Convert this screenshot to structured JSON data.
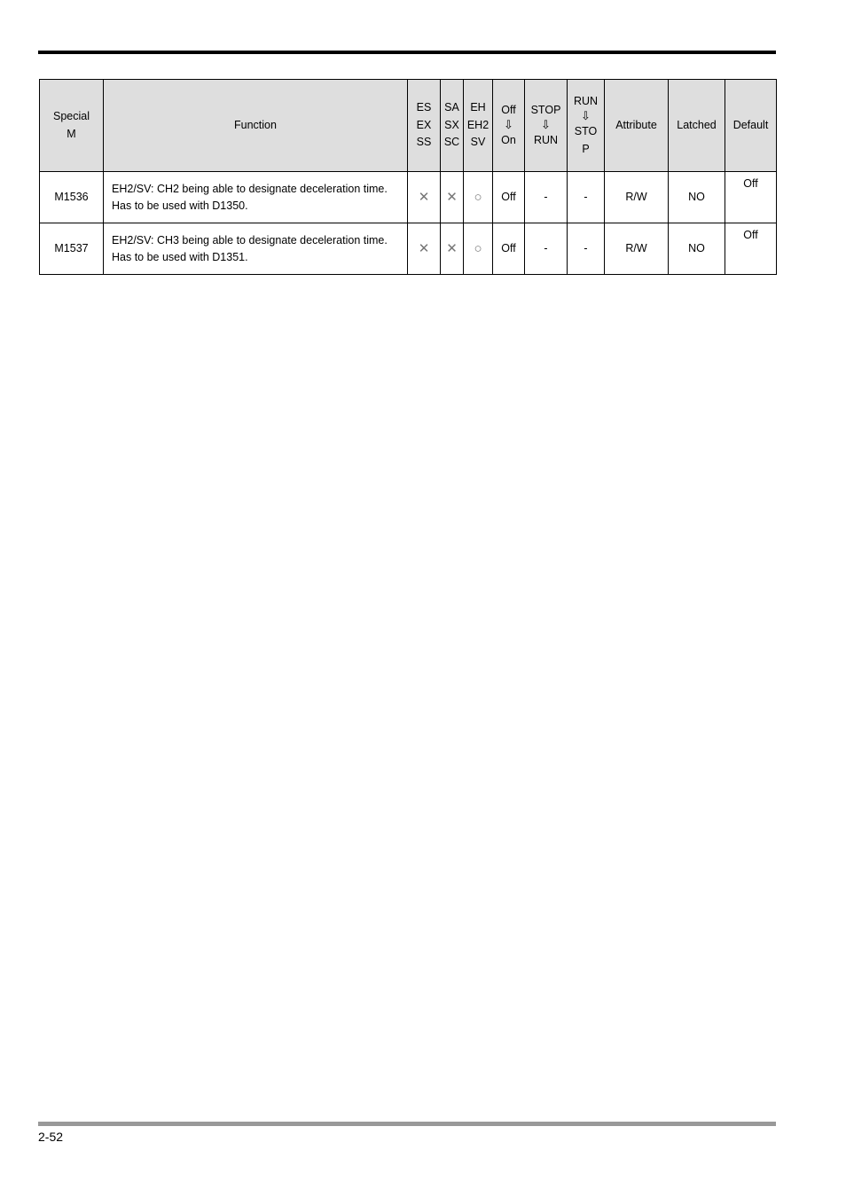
{
  "page": {
    "page_number": "2-52"
  },
  "table": {
    "headers": {
      "special_m": "Special\nM",
      "special_m_line1": "Special",
      "special_m_line2": "M",
      "function": "Function",
      "es_line1": "ES",
      "es_line2": "EX",
      "es_line3": "SS",
      "sa_line1": "SA",
      "sa_line2": "SX",
      "sa_line3": "SC",
      "eh_line1": "EH",
      "eh_line2": "EH2",
      "eh_line3": "SV",
      "off_on_line1": "Off",
      "off_on_arrow": "⇩",
      "off_on_line3": "On",
      "stop_run_line1": "STOP",
      "stop_run_arrow": "⇩",
      "stop_run_line3": "RUN",
      "run_stop_line1": "RUN",
      "run_stop_arrow": "⇩",
      "run_stop_line3": "STO",
      "run_stop_line4": "P",
      "attribute": "Attribute",
      "latched": "Latched",
      "default": "Default"
    },
    "rows": [
      {
        "special_m": "M1536",
        "function": "EH2/SV: CH2 being able to designate deceleration time. Has to be used with D1350.",
        "es": "✕",
        "sa": "✕",
        "eh": "○",
        "off_on": "Off",
        "stop_run": "-",
        "run_stop": "-",
        "attribute": "R/W",
        "latched": "NO",
        "default": "Off"
      },
      {
        "special_m": "M1537",
        "function": "EH2/SV: CH3 being able to designate deceleration time. Has to be used with D1351.",
        "es": "✕",
        "sa": "✕",
        "eh": "○",
        "off_on": "Off",
        "stop_run": "-",
        "run_stop": "-",
        "attribute": "R/W",
        "latched": "NO",
        "default": "Off"
      }
    ]
  },
  "colors": {
    "header_fill": "#dedede",
    "border": "#000000",
    "header_rule": "#000000",
    "footer_rule": "#999999",
    "symbol_gray": "#767676"
  }
}
